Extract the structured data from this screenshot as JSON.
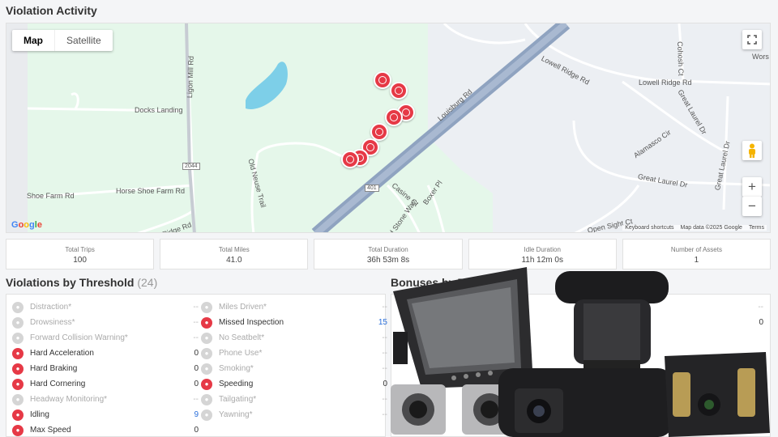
{
  "violation_activity": {
    "title": "Violation Activity"
  },
  "map": {
    "toggle": {
      "map": "Map",
      "satellite": "Satellite"
    },
    "fullscreen_icon": "fullscreen-icon",
    "zoom_in": "+",
    "zoom_out": "−",
    "pegman_icon": "pegman-icon",
    "labels": {
      "ligon_mill": "Ligon Mill Rd",
      "docks_landing": "Docks Landing",
      "horse_shoe": "Horse Shoe Farm Rd",
      "shoe_farm": "Shoe Farm Rd",
      "ridge_rd": "er Ridge Rd",
      "old_neuse": "Old Neuse Trail",
      "louisburg": "Louisburg Rd",
      "lowell_ridge_curve": "Lowell Ridge Rd",
      "lowell_ridge": "Lowell Ridge Rd",
      "cohosh": "Cohosh Ct",
      "great_laurel_curve": "Great Laurel Dr",
      "great_laurel_vert": "Great Laurel Dr",
      "great_laurel": "Great Laurel Dr",
      "alamasco": "Alamasco Cir",
      "casine": "Casine Ct",
      "boxer": "Boxer Pl",
      "stone_way": "d Stone Way",
      "open_sight": "Open Sight Ct",
      "wors": "Wors",
      "shield_2044": "2044",
      "shield_401": "401"
    },
    "google": "Google",
    "attribution": [
      "Keyboard shortcuts",
      "Map data ©2025 Google",
      "Terms"
    ],
    "marker_count": 8
  },
  "stats": [
    {
      "label": "Total Trips",
      "value": "100"
    },
    {
      "label": "Total Miles",
      "value": "41.0"
    },
    {
      "label": "Total Duration",
      "value": "36h 53m 8s"
    },
    {
      "label": "Idle Duration",
      "value": "11h 12m 0s"
    },
    {
      "label": "Number of Assets",
      "value": "1"
    }
  ],
  "violations": {
    "title": "Violations by Threshold",
    "count": "(24)",
    "left": [
      {
        "name": "Distraction*",
        "value": "--",
        "active": false
      },
      {
        "name": "Drowsiness*",
        "value": "--",
        "active": false
      },
      {
        "name": "Forward Collision Warning*",
        "value": "--",
        "active": false
      },
      {
        "name": "Hard Acceleration",
        "value": "0",
        "active": true
      },
      {
        "name": "Hard Braking",
        "value": "0",
        "active": true
      },
      {
        "name": "Hard Cornering",
        "value": "0",
        "active": true
      },
      {
        "name": "Headway Monitoring*",
        "value": "--",
        "active": false
      },
      {
        "name": "Idling",
        "value": "9",
        "active": true,
        "link": true
      },
      {
        "name": "Max Speed",
        "value": "0",
        "active": true
      }
    ],
    "right": [
      {
        "name": "Miles Driven*",
        "value": "--",
        "active": false
      },
      {
        "name": "Missed Inspection",
        "value": "15",
        "active": true,
        "link": true
      },
      {
        "name": "No Seatbelt*",
        "value": "--",
        "active": false
      },
      {
        "name": "Phone Use*",
        "value": "--",
        "active": false
      },
      {
        "name": "Smoking*",
        "value": "--",
        "active": false
      },
      {
        "name": "Speeding",
        "value": "0",
        "active": true
      },
      {
        "name": "Tailgating*",
        "value": "--",
        "active": false
      },
      {
        "name": "Yawning*",
        "value": "--",
        "active": false
      }
    ]
  },
  "bonuses": {
    "title": "Bonuses by Th",
    "row1_value": "--",
    "row2_value": "0"
  },
  "colors": {
    "accent_red": "#e63946",
    "link_blue": "#2a6fdb",
    "road_blue": "#8fa3c0",
    "water": "#7dcfe8"
  }
}
